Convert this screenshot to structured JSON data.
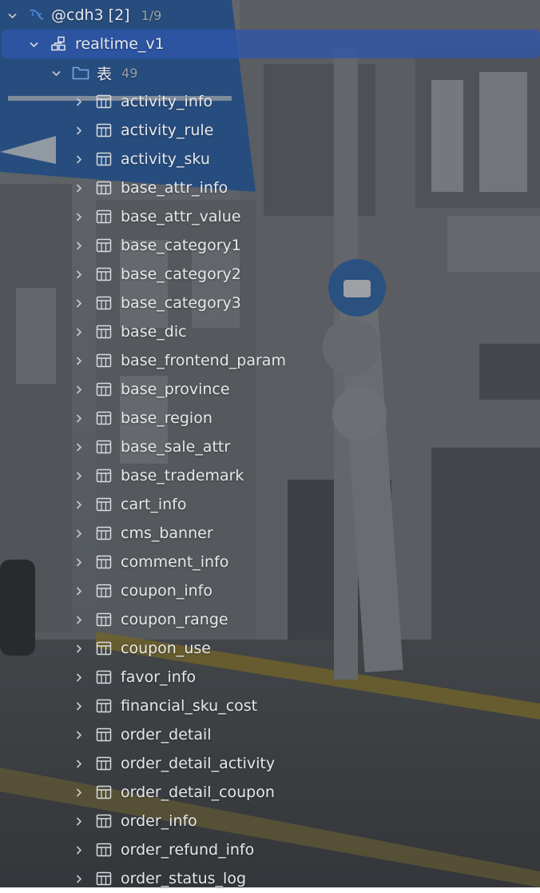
{
  "tree": {
    "connection": {
      "label": "@cdh3 [2]",
      "count": "1/9",
      "icon": "mysql-dolphin-icon"
    },
    "schema": {
      "label": "realtime_v1",
      "icon": "schema-icon"
    },
    "folder": {
      "label": "表",
      "count": "49",
      "icon": "folder-icon"
    },
    "tables": [
      "activity_info",
      "activity_rule",
      "activity_sku",
      "base_attr_info",
      "base_attr_value",
      "base_category1",
      "base_category2",
      "base_category3",
      "base_dic",
      "base_frontend_param",
      "base_province",
      "base_region",
      "base_sale_attr",
      "base_trademark",
      "cart_info",
      "cms_banner",
      "comment_info",
      "coupon_info",
      "coupon_range",
      "coupon_use",
      "favor_info",
      "financial_sku_cost",
      "order_detail",
      "order_detail_activity",
      "order_detail_coupon",
      "order_info",
      "order_refund_info",
      "order_status_log"
    ]
  },
  "colors": {
    "selection": "#2e56aa",
    "text": "#e6e8ec",
    "muted": "#9aa0a8",
    "folder_icon": "#7aa7e8",
    "dolphin_icon": "#4a8fe0"
  }
}
